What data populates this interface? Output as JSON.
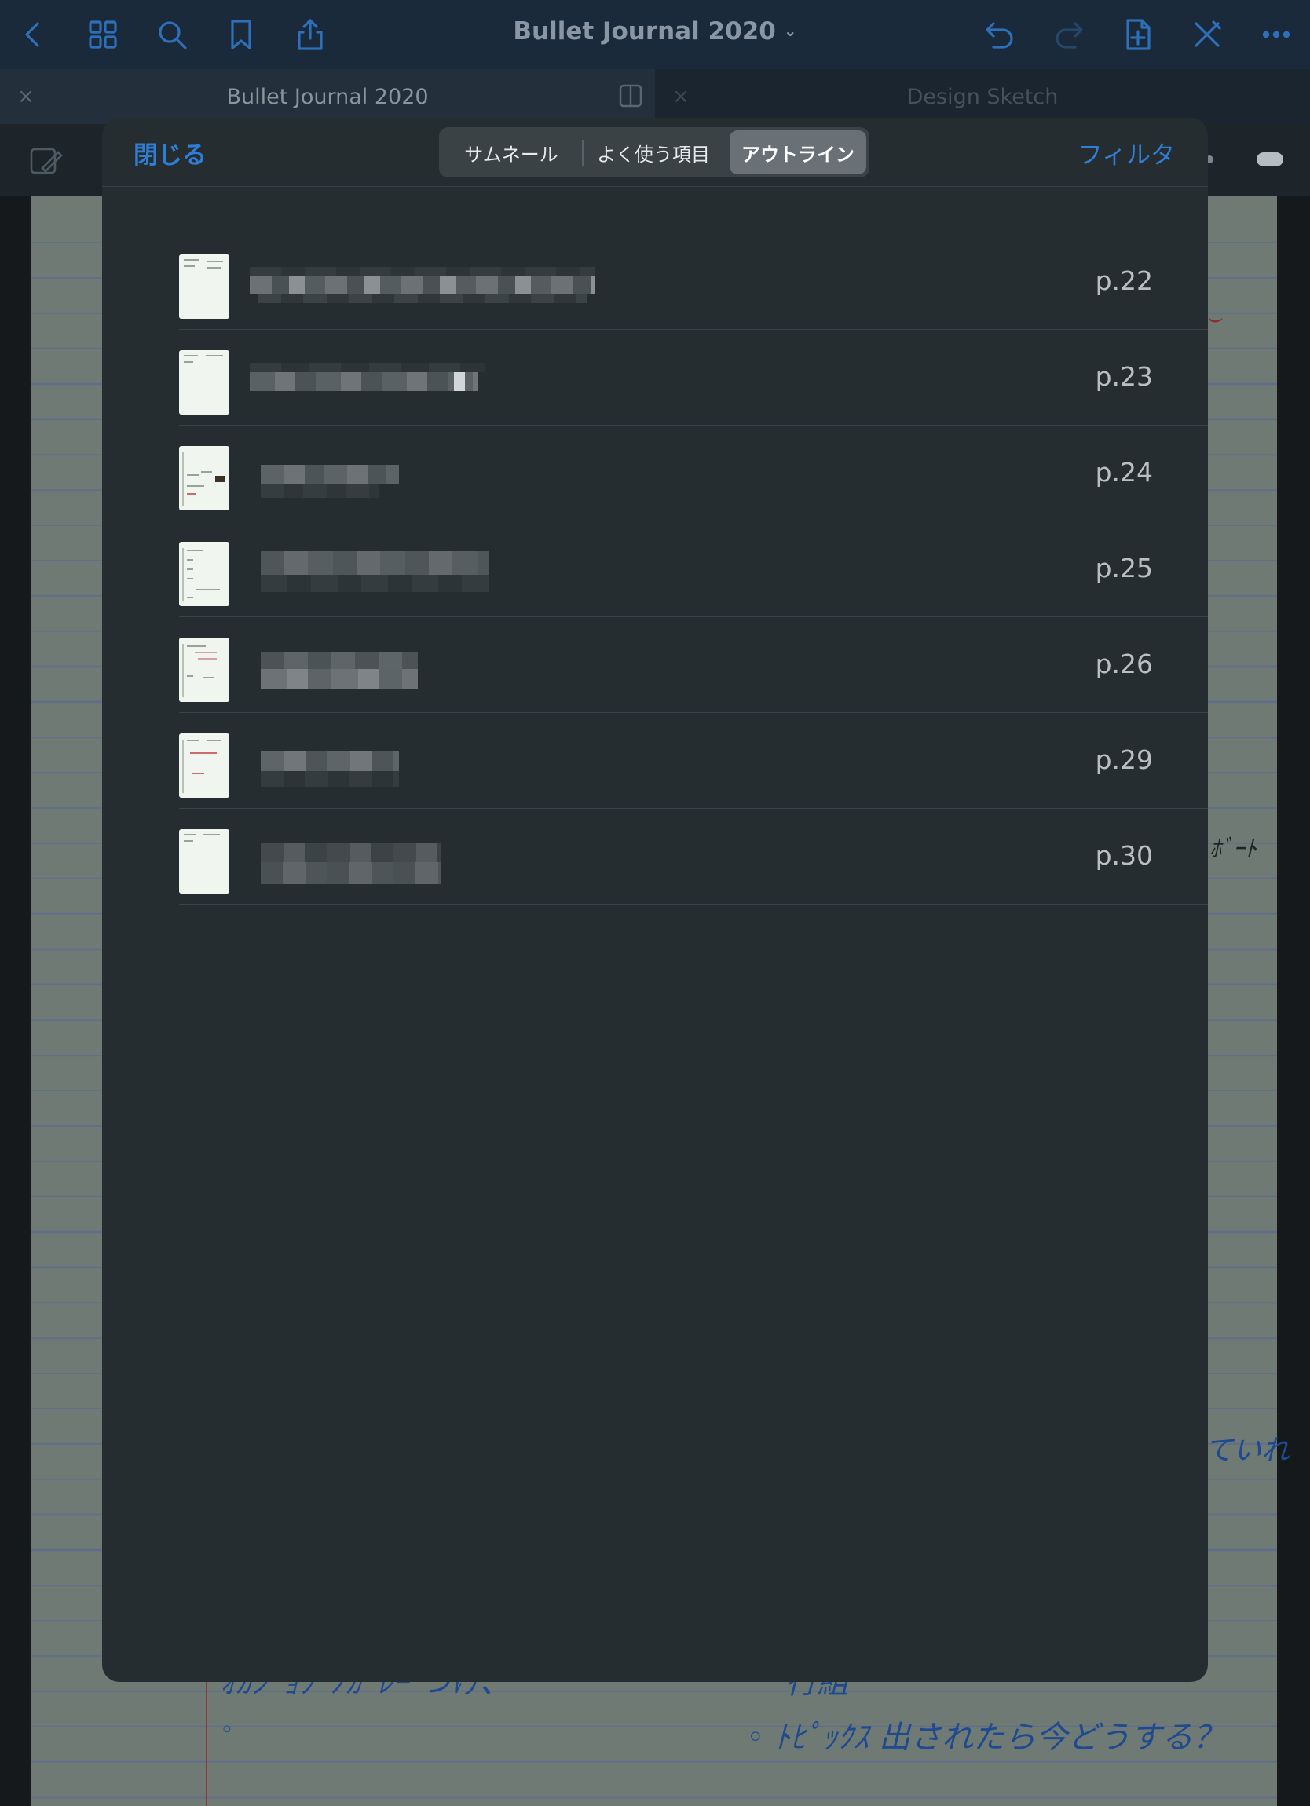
{
  "topbar": {
    "title": "Bullet Journal 2020",
    "title_chevron": "⌄",
    "icons": [
      "back-icon",
      "grid-icon",
      "search-icon",
      "bookmark-icon",
      "share-icon",
      "undo-icon",
      "redo-icon",
      "add-page-icon",
      "pen-off-icon",
      "more-icon"
    ]
  },
  "tabs": [
    {
      "label": "Bullet Journal 2020",
      "close": "×"
    },
    {
      "label": "Design Sketch",
      "close": "×"
    }
  ],
  "modal": {
    "close_label": "閉じる",
    "filter_label": "フィルタ",
    "segments": [
      "サムネール",
      "よく使う項目",
      "アウトライン"
    ],
    "selected_segment": "アウトライン",
    "outline_items": [
      {
        "page": "p.22"
      },
      {
        "page": "p.23"
      },
      {
        "page": "p.24"
      },
      {
        "page": "p.25"
      },
      {
        "page": "p.26"
      },
      {
        "page": "p.29"
      },
      {
        "page": "p.30"
      }
    ]
  },
  "background_handwriting": [
    {
      "text": "ﾎﾞｰﾄ"
    },
    {
      "text": "ていれ"
    },
    {
      "text": "ｵｶｼﾞｮﾌﾞﾉｶﾞﾚｰ つけ、"
    },
    {
      "text": "行組"
    },
    {
      "text": "◦ ﾄﾋﾟｯｸｽ 出されたら今どうする？"
    },
    {
      "text": "◦"
    }
  ],
  "colors": {
    "accent": "#2f7ed6",
    "modal_bg": "#262d30",
    "topbar_bg": "#1a2a3a",
    "thumbnail_bg": "#f1f5ef"
  }
}
